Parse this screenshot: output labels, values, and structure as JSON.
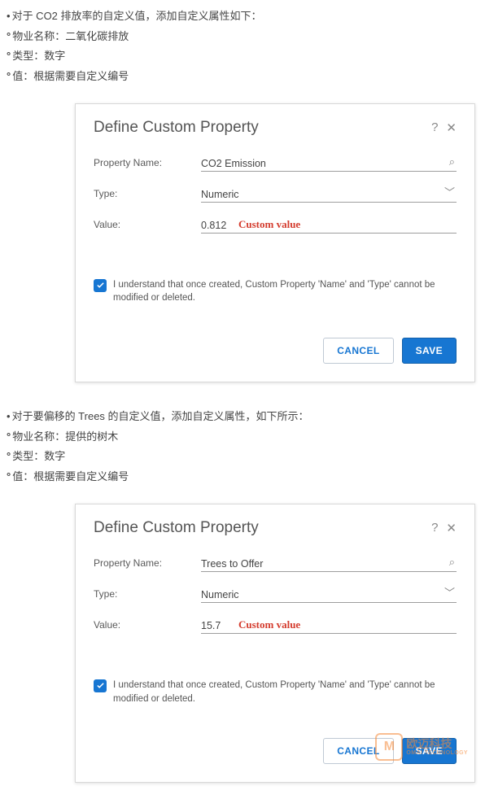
{
  "sections": {
    "a": {
      "intro": "对于 CO2 排放率的自定义值，添加自定义属性如下：",
      "name_line": "物业名称：二氧化碳排放",
      "type_line": "类型：数字",
      "value_line": "值：根据需要自定义编号"
    },
    "b": {
      "intro": "对于要偏移的 Trees 的自定义值，添加自定义属性，如下所示：",
      "name_line": "物业名称：提供的树木",
      "type_line": "类型：数字",
      "value_line": "值：根据需要自定义编号"
    }
  },
  "dialog": {
    "title": "Define Custom Property",
    "labels": {
      "name": "Property Name:",
      "type": "Type:",
      "value": "Value:"
    },
    "type_value": "Numeric",
    "custom_value_note": "Custom value",
    "consent": "I understand that once created, Custom Property 'Name' and 'Type' cannot be modified or deleted.",
    "buttons": {
      "cancel": "CANCEL",
      "save": "SAVE"
    },
    "help": "?",
    "close": "✕",
    "search_icon": "⌕",
    "chevron": "﹀"
  },
  "dialogs": {
    "co2": {
      "name": "CO2 Emission",
      "value": "0.812"
    },
    "trees": {
      "name": "Trees to Offer",
      "value": "15.7"
    }
  },
  "watermark": {
    "initial": "M",
    "cn": "欧迈科技",
    "en": "OMAI TECHNOLOGY"
  }
}
